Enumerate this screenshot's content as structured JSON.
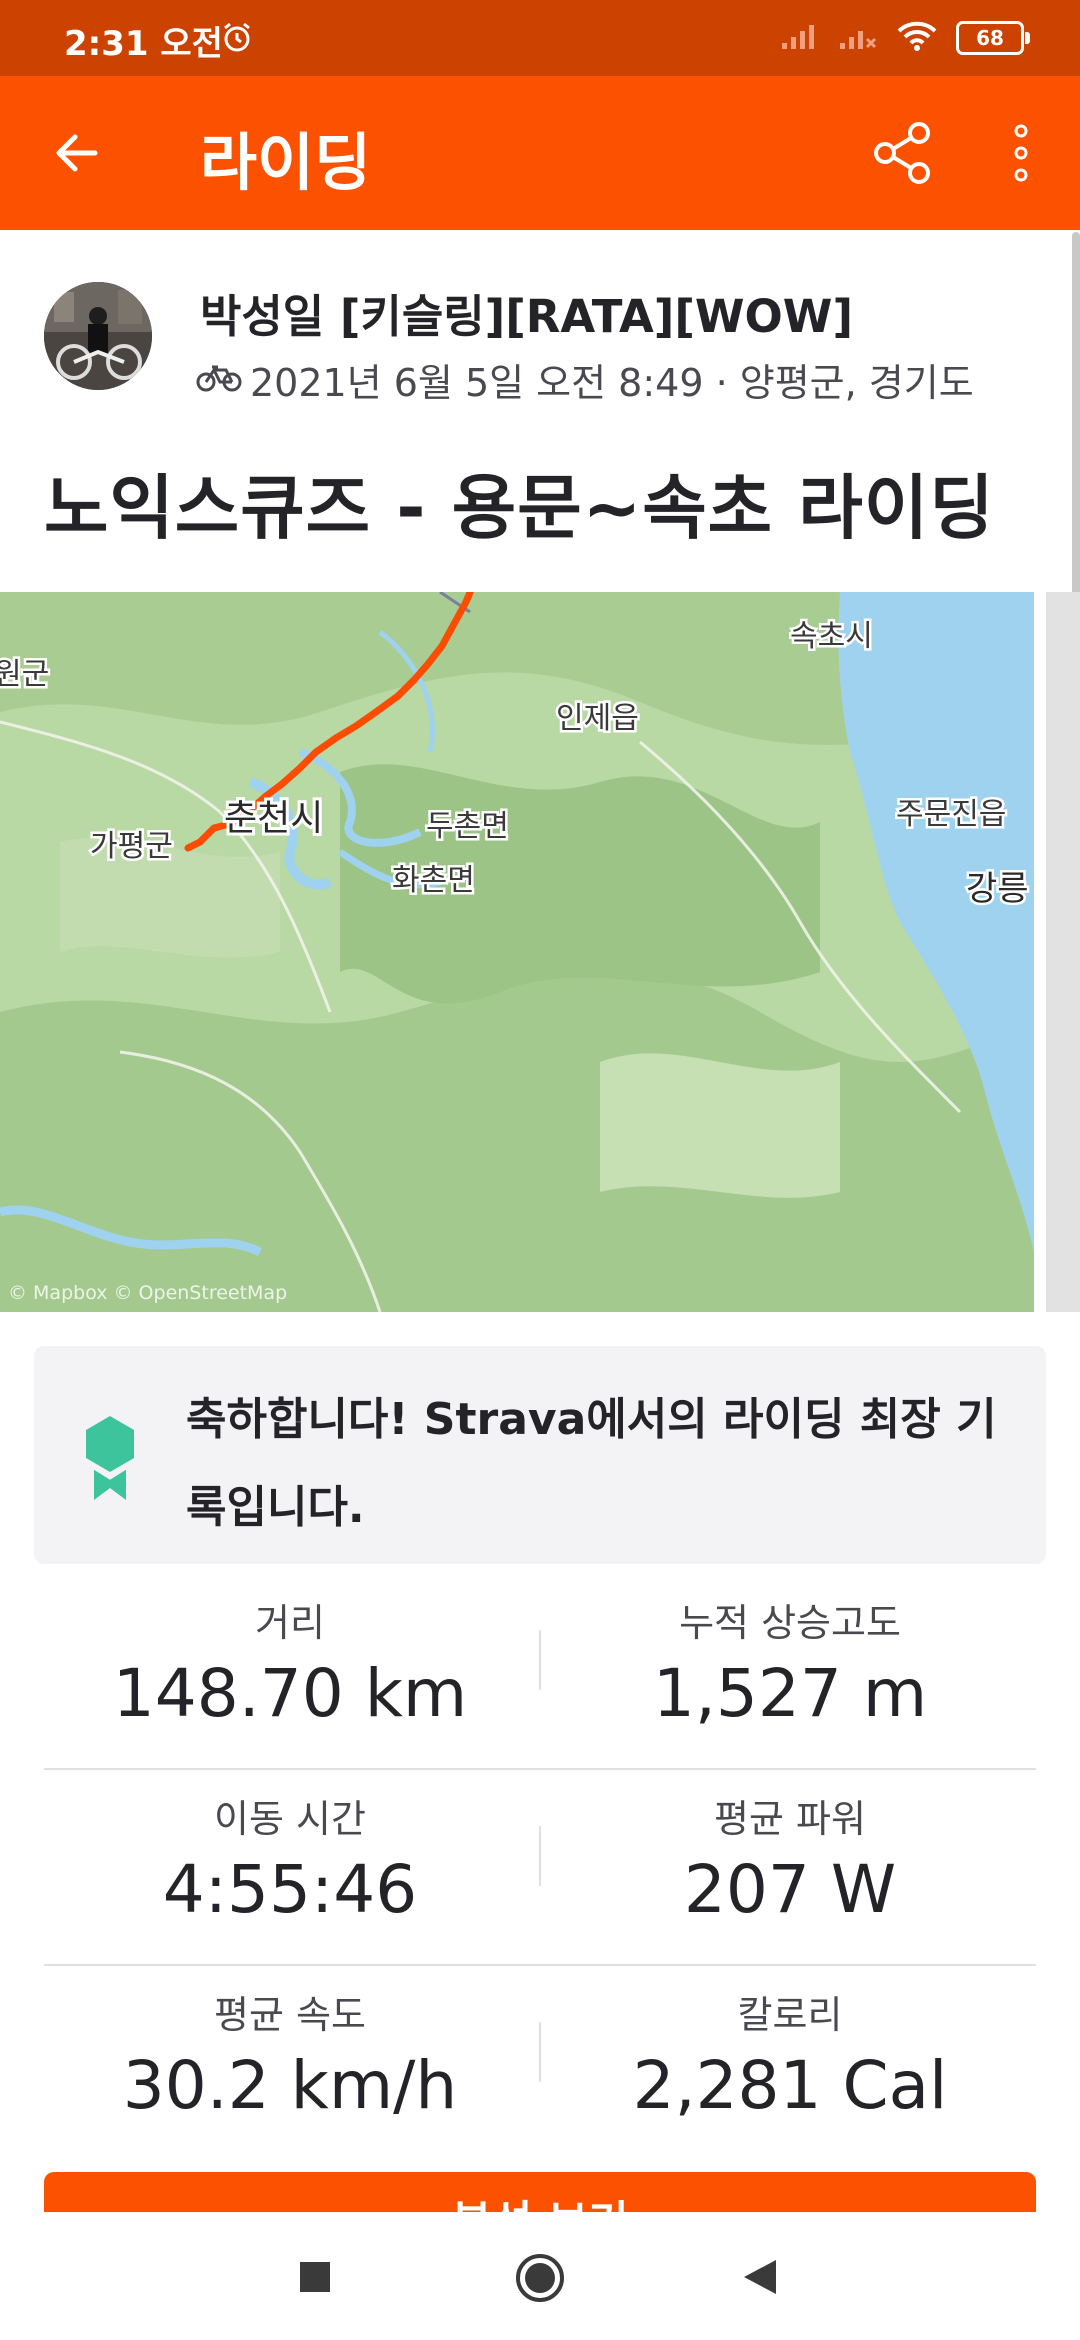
{
  "status_bar": {
    "time": "2:31 오전",
    "battery": "68"
  },
  "app_bar": {
    "title": "라이딩",
    "back_icon": "arrow-left-icon",
    "share_icon": "share-icon",
    "more_icon": "more-vertical-icon"
  },
  "athlete": {
    "name": "박성일 [키슬링][RATA][WOW]",
    "activity_icon": "bike-icon",
    "meta": "2021년 6월 5일 오전 8:49 · 양평군, 경기도"
  },
  "activity": {
    "title": "노익스큐즈 - 용문~속초 라이딩"
  },
  "map": {
    "labels": [
      "속초시",
      "원군",
      "인제읍",
      "주문진읍",
      "춘천시",
      "두촌면",
      "가평군",
      "화촌면",
      "강릉"
    ],
    "attribution": "© Mapbox © OpenStreetMap",
    "route_color": "#fc4c02",
    "water_color": "#9fd2ef"
  },
  "achievement": {
    "icon": "medal-icon",
    "text": "축하합니다! Strava에서의 라이딩 최장 기록입니다."
  },
  "stats": [
    {
      "label": "거리",
      "value": "148.70 km"
    },
    {
      "label": "누적 상승고도",
      "value": "1,527 m"
    },
    {
      "label": "이동 시간",
      "value": "4:55:46"
    },
    {
      "label": "평균 파워",
      "value": "207 W"
    },
    {
      "label": "평균 속도",
      "value": "30.2 km/h"
    },
    {
      "label": "칼로리",
      "value": "2,281 Cal"
    }
  ],
  "analysis_button": {
    "label": "분석 보기"
  },
  "nav_bar": {
    "recents": "square-icon",
    "home": "circle-icon",
    "back": "triangle-back-icon"
  },
  "colors": {
    "brand": "#fc5200",
    "status_bar": "#cc4200"
  }
}
